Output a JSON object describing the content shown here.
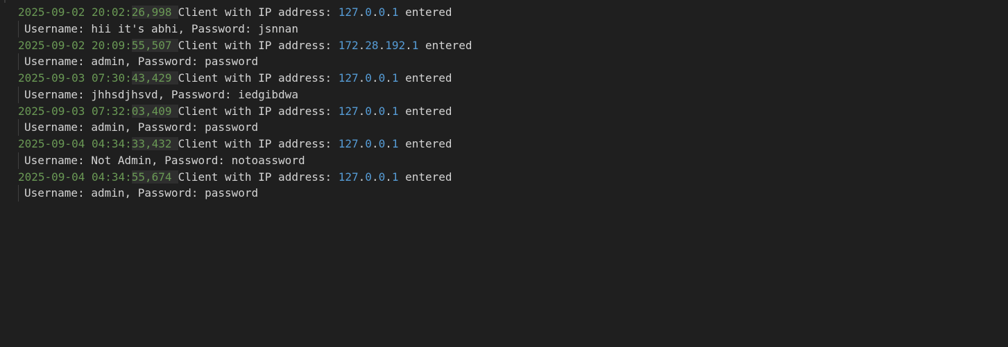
{
  "log": {
    "entries": [
      {
        "timestamp": "2025-09-02 20:02:26,998",
        "message_prefix": "Client with IP address: ",
        "ip": [
          "127",
          "0",
          "0",
          "1"
        ],
        "message_suffix": " entered",
        "detail": "Username: hii it's abhi, Password: jsnnan"
      },
      {
        "timestamp": "2025-09-02 20:09:55,507",
        "message_prefix": "Client with IP address: ",
        "ip": [
          "172",
          "28",
          "192",
          "1"
        ],
        "message_suffix": " entered",
        "detail": "Username: admin, Password: password"
      },
      {
        "timestamp": "2025-09-03 07:30:43,429",
        "message_prefix": "Client with IP address: ",
        "ip": [
          "127",
          "0",
          "0",
          "1"
        ],
        "message_suffix": " entered",
        "detail": "Username: jhhsdjhsvd, Password: iedgibdwa"
      },
      {
        "timestamp": "2025-09-03 07:32:03,409",
        "message_prefix": "Client with IP address: ",
        "ip": [
          "127",
          "0",
          "0",
          "1"
        ],
        "message_suffix": " entered",
        "detail": "Username: admin, Password: password"
      },
      {
        "timestamp": "2025-09-04 04:34:33,432",
        "message_prefix": "Client with IP address: ",
        "ip": [
          "127",
          "0",
          "0",
          "1"
        ],
        "message_suffix": " entered",
        "detail": "Username: Not Admin, Password: notoassword"
      },
      {
        "timestamp": "2025-09-04 04:34:55,674",
        "message_prefix": "Client with IP address: ",
        "ip": [
          "127",
          "0",
          "0",
          "1"
        ],
        "message_suffix": " entered",
        "detail": "Username: admin, Password: password"
      }
    ]
  },
  "colors": {
    "background": "#1f1f1f",
    "text": "#d4d4d4",
    "timestamp": "#6a9955",
    "number": "#569cd6"
  }
}
